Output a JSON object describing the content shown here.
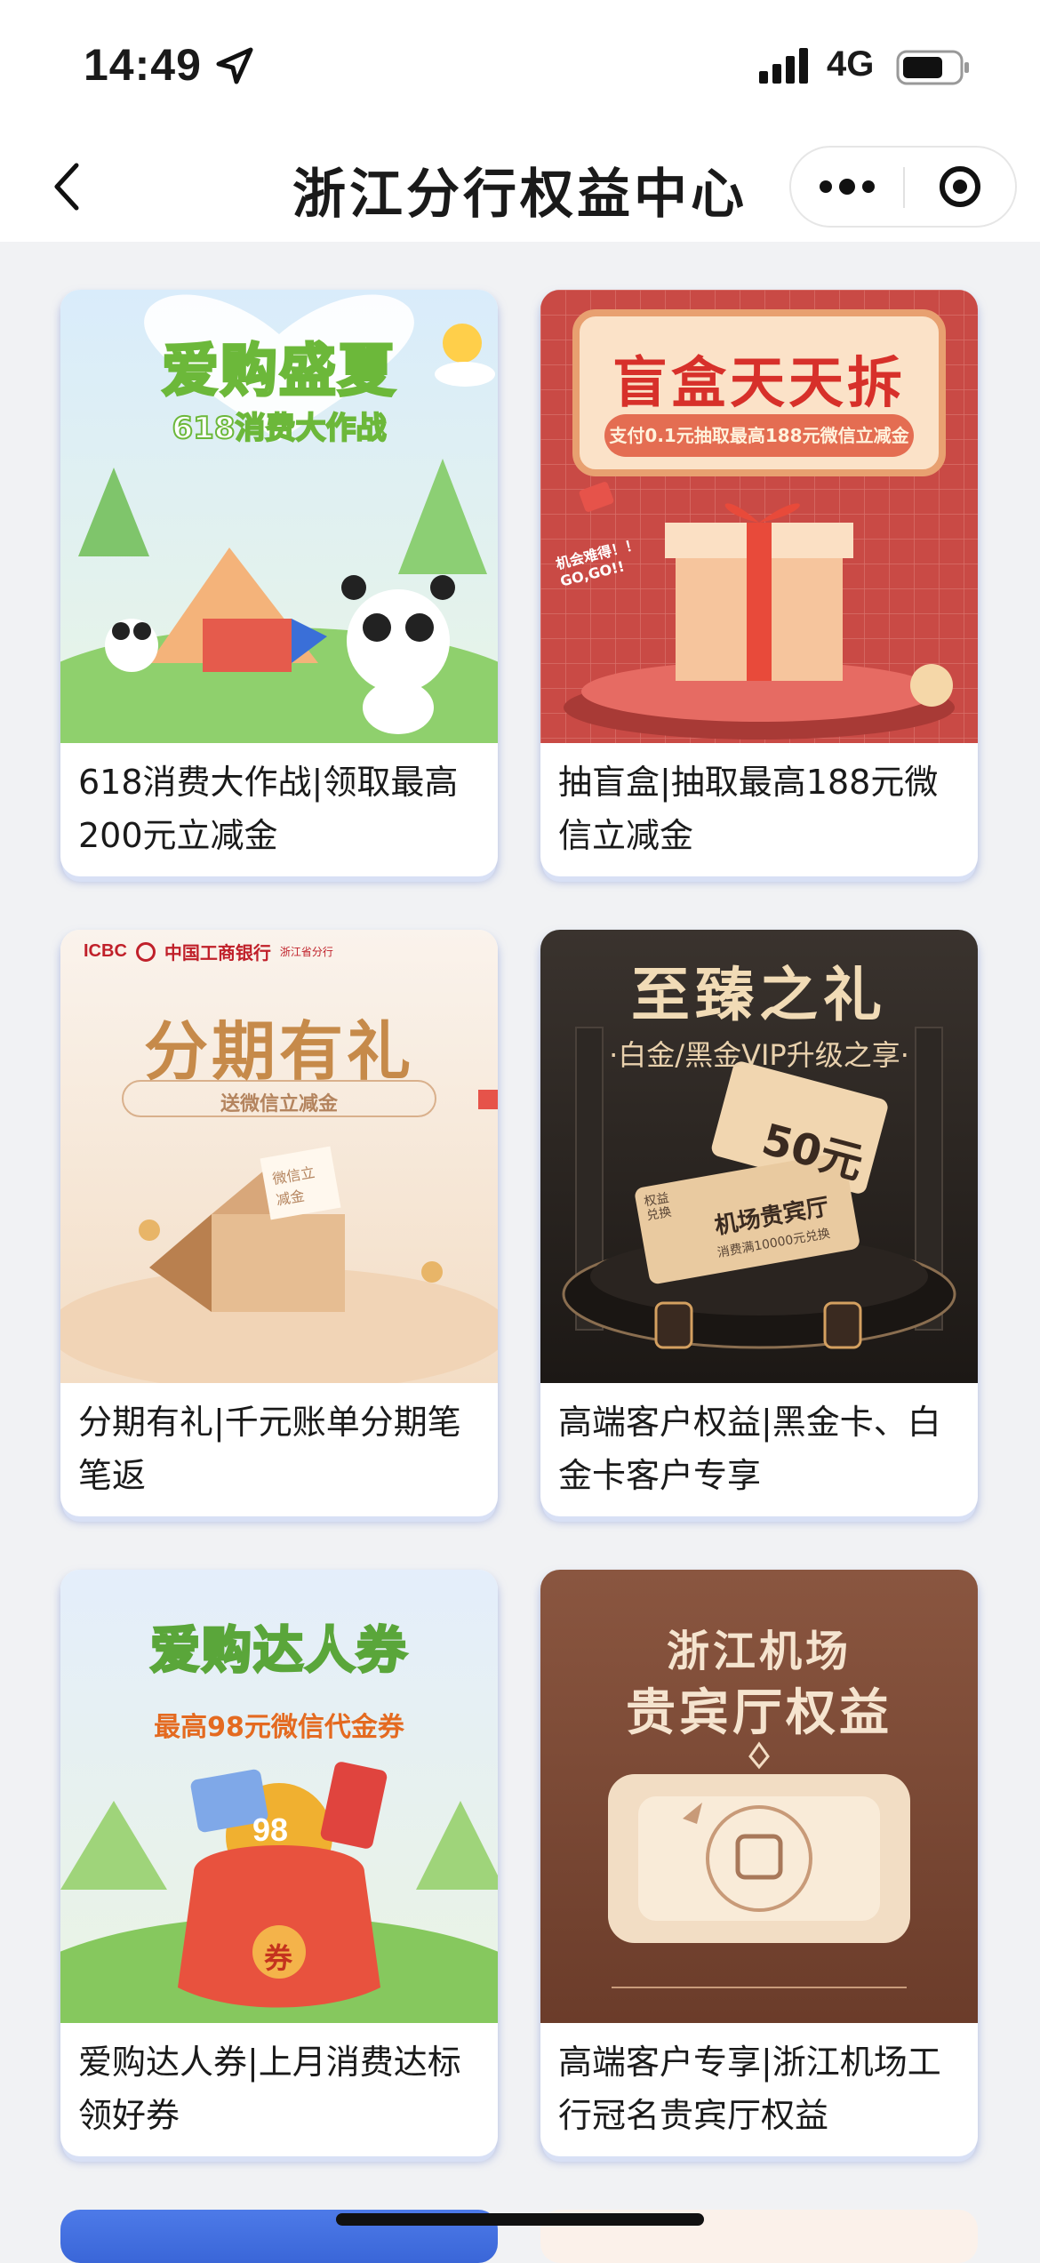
{
  "status_bar": {
    "time": "14:49",
    "network": "4G",
    "icons": [
      "location-arrow-icon",
      "signal-icon",
      "battery-icon"
    ]
  },
  "nav": {
    "title": "浙江分行权益中心",
    "back_icon": "chevron-left-icon",
    "more_icon": "more-dots-icon",
    "close_icon": "close-target-icon"
  },
  "cards": [
    {
      "caption": "618消费大作战|领取最高200元立减金",
      "banner": {
        "title": "爱购盛夏",
        "subtitle": "618消费大作战"
      }
    },
    {
      "caption": "抽盲盒|抽取最高188元微信立减金",
      "banner": {
        "title": "盲盒天天拆",
        "subtitle": "支付0.1元抽取最高188元微信立减金",
        "sticker": "机会难得！！ GO,GO!!"
      }
    },
    {
      "caption": "分期有礼|千元账单分期笔笔返",
      "banner": {
        "bank_code": "ICBC",
        "bank_name": "中国工商银行",
        "branch": "浙江省分行",
        "title": "分期有礼",
        "subtitle": "送微信立减金",
        "card_text": "微信立减金"
      }
    },
    {
      "caption": "高端客户权益|黑金卡、白金卡客户专享",
      "banner": {
        "title": "至臻之礼",
        "subtitle": "·白金/黑金VIP升级之享·",
        "ticket_value": "50元",
        "ticket_title": "机场贵宾厅",
        "ticket_note": "消费满10000元兑换",
        "ticket_tag": "权益兑换"
      }
    },
    {
      "caption": "爱购达人券|上月消费达标领好券",
      "banner": {
        "title": "爱购达人券",
        "subtitle": "最高98元微信代金券",
        "coin": "98",
        "bag_label": "券"
      }
    },
    {
      "caption": "高端客户专享|浙江机场工行冠名贵宾厅权益",
      "banner": {
        "title": "浙江机场",
        "subtitle": "贵宾厅权益"
      }
    }
  ],
  "colors": {
    "background": "#f1f2f4",
    "card_shadow": "#8c9ee0",
    "blindbox_red": "#c94a45",
    "vip_dark": "#2b2622",
    "lounge_brown": "#7a4a36"
  }
}
